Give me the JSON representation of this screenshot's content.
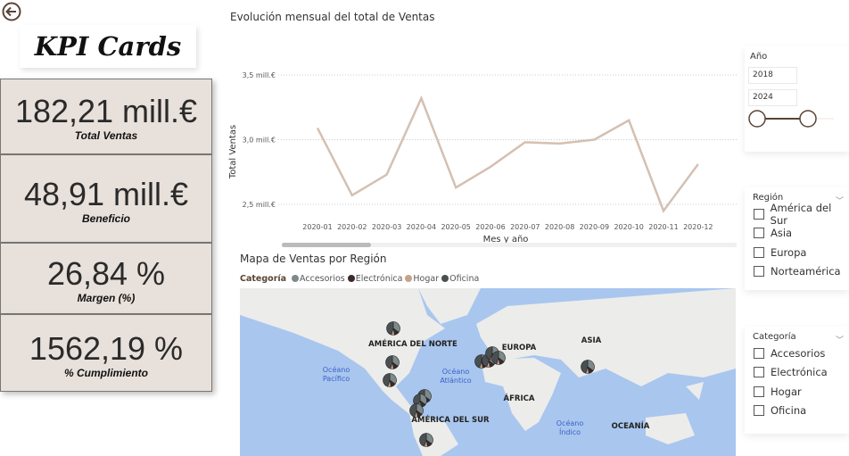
{
  "nav": {
    "back_icon": "arrow-left-circle-icon"
  },
  "title": "KPI Cards",
  "kpis": [
    {
      "value": "182,21 mill.€",
      "label": "Total Ventas"
    },
    {
      "value": "48,91 mill.€",
      "label": "Beneficio"
    },
    {
      "value": "26,84 %",
      "label": "Margen (%)"
    },
    {
      "value": "1562,19 %",
      "label": "% Cumplimiento"
    }
  ],
  "chart_data": {
    "type": "line",
    "title": "Evolución mensual del total de Ventas",
    "xlabel": "Mes y año",
    "ylabel": "Total Ventas",
    "categories": [
      "2020-01",
      "2020-02",
      "2020-03",
      "2020-04",
      "2020-05",
      "2020-06",
      "2020-07",
      "2020-08",
      "2020-09",
      "2020-10",
      "2020-11",
      "2020-12"
    ],
    "values": [
      3.09,
      2.57,
      2.73,
      3.32,
      2.63,
      2.79,
      2.98,
      2.97,
      3.0,
      3.15,
      2.45,
      2.81
    ],
    "unit": "mill.€",
    "yticks": [
      "2,5 mill.€",
      "3,0 mill.€",
      "3,5 mill.€"
    ],
    "ytick_values": [
      2.5,
      3.0,
      3.5
    ],
    "ylim": [
      2.5,
      3.5
    ],
    "grid": true,
    "line_color": "#d4c0b2"
  },
  "map": {
    "title": "Mapa de Ventas por Región",
    "legend_title": "Categoría",
    "legend": [
      {
        "name": "Accesorios",
        "color": "#7d8a8c"
      },
      {
        "name": "Electrónica",
        "color": "#3a2a28"
      },
      {
        "name": "Hogar",
        "color": "#c4a38a"
      },
      {
        "name": "Oficina",
        "color": "#4a4f52"
      }
    ],
    "labels": {
      "na": "AMÉRICA DEL NORTE",
      "eu": "EUROPA",
      "as": "ASIA",
      "af": "ÁFRICA",
      "sa": "AMÉRICA DEL SUR",
      "oc": "OCEANÍA",
      "pac1": "Océano",
      "pac2": "Pacífico",
      "atl1": "Océano",
      "atl2": "Atlántico",
      "ind1": "Océano",
      "ind2": "Índico"
    }
  },
  "year_slicer": {
    "title": "Año",
    "from": "2018",
    "to": "2024"
  },
  "region_slicer": {
    "title": "Región",
    "items": [
      "América del Sur",
      "Asia",
      "Europa",
      "Norteamérica"
    ]
  },
  "category_slicer": {
    "title": "Categoría",
    "items": [
      "Accesorios",
      "Electrónica",
      "Hogar",
      "Oficina"
    ]
  }
}
